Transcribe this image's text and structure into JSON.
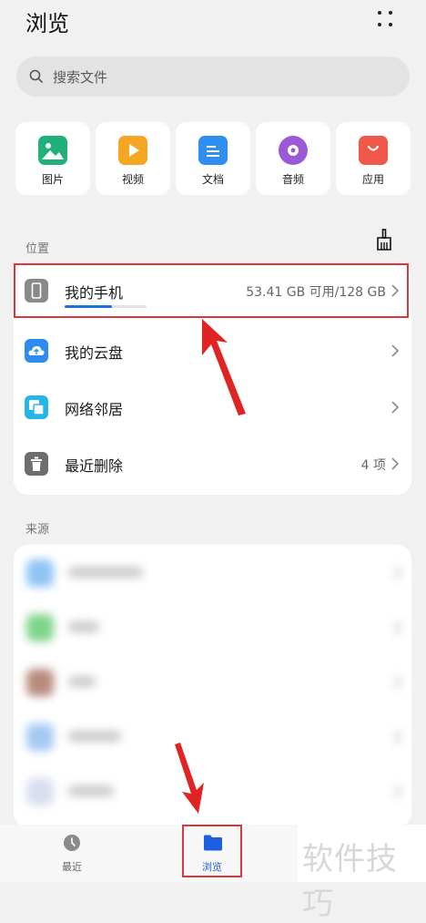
{
  "header": {
    "title": "浏览",
    "more_icon": "more-dots-icon"
  },
  "search": {
    "placeholder": "搜索文件"
  },
  "categories": [
    {
      "label": "图片",
      "icon": "image-icon",
      "color": "#21b07a"
    },
    {
      "label": "视频",
      "icon": "video-icon",
      "color": "#f5a623"
    },
    {
      "label": "文档",
      "icon": "document-icon",
      "color": "#2f8ff0"
    },
    {
      "label": "音频",
      "icon": "audio-icon",
      "color": "#9b59d8"
    },
    {
      "label": "应用",
      "icon": "app-store-icon",
      "color": "#f0584a"
    }
  ],
  "location": {
    "section_label": "位置",
    "clean_icon": "broom-icon",
    "items": [
      {
        "label": "我的手机",
        "value": "53.41 GB 可用/128 GB",
        "storage_used_fraction": 0.58,
        "icon": "phone-icon",
        "color": "#8a8a8a"
      },
      {
        "label": "我的云盘",
        "value": "",
        "icon": "cloud-icon",
        "color": "#2e8cf0"
      },
      {
        "label": "网络邻居",
        "value": "",
        "icon": "network-icon",
        "color": "#25b5e8"
      },
      {
        "label": "最近删除",
        "value": "4 项",
        "icon": "trash-icon",
        "color": "#6e6e6e"
      }
    ]
  },
  "sources": {
    "section_label": "来源"
  },
  "nav": {
    "recent": {
      "label": "最近",
      "icon": "clock-icon"
    },
    "browse": {
      "label": "浏览",
      "icon": "folder-icon"
    }
  },
  "watermark": "软件技巧",
  "colors": {
    "accent": "#1e6fe0",
    "highlight": "#d9363e"
  }
}
